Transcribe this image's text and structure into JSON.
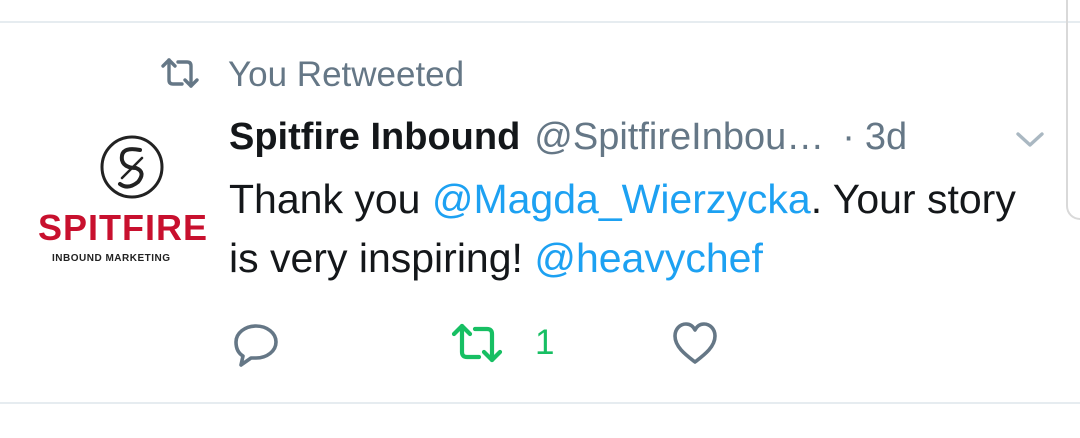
{
  "retweet_context": {
    "icon": "retweet-icon",
    "label": "You Retweeted"
  },
  "avatar": {
    "icon": "spitfire-logo",
    "brand_text": "SPITFIRE",
    "brand_sub": "INBOUND MARKETING",
    "brand_color": "#c8102e"
  },
  "tweet": {
    "author_name": "Spitfire Inbound",
    "author_handle": "@SpitfireInbou…",
    "separator": "·",
    "time": "3d",
    "text_parts": [
      {
        "text": "Thank you ",
        "mention": false
      },
      {
        "text": "@Magda_Wierzycka",
        "mention": true
      },
      {
        "text": ". Your story is very inspiring! ",
        "mention": false
      },
      {
        "text": "@heavychef",
        "mention": true
      }
    ],
    "menu_icon": "chevron-down-icon"
  },
  "actions": {
    "reply": {
      "icon": "reply-icon"
    },
    "retweet": {
      "icon": "retweet-icon",
      "count": "1",
      "active": true
    },
    "like": {
      "icon": "heart-icon"
    }
  },
  "colors": {
    "text": "#14171a",
    "secondary": "#657786",
    "link": "#1da1f2",
    "retweet_active": "#17bf63",
    "divider": "#e6ecf0"
  }
}
